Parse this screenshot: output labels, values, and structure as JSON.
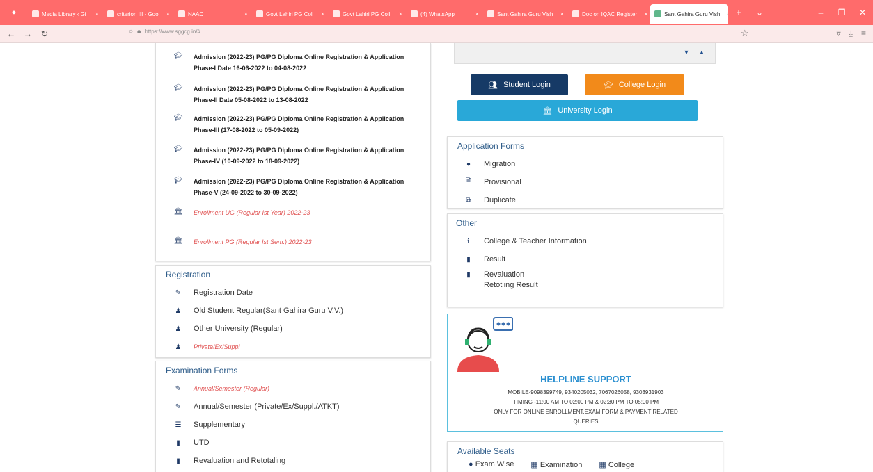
{
  "browser": {
    "tabs": [
      {
        "label": "Media Library ‹ Gi",
        "active": false
      },
      {
        "label": "criterion III - Goo",
        "active": false
      },
      {
        "label": "NAAC",
        "active": false
      },
      {
        "label": "Govt Lahiri PG Coll",
        "active": false
      },
      {
        "label": "Govt Lahiri PG Coll",
        "active": false
      },
      {
        "label": "(4) WhatsApp",
        "active": false
      },
      {
        "label": "Sant Gahira Guru Vish",
        "active": false
      },
      {
        "label": "Doc on IQAC Register",
        "active": false
      },
      {
        "label": "Sant Gahira Guru Vish",
        "active": true
      }
    ],
    "url": "https://www.sggcg.in/#"
  },
  "news": [
    {
      "text": "Admission (2022-23) PG/PG Diploma Online Registration & Application Phase-I Date 16-06-2022 to 04-08-2022",
      "style": "bold"
    },
    {
      "text": "Admission (2022-23) PG/PG Diploma Online Registration & Application Phase-II Date 05-08-2022 to 13-08-2022",
      "style": "bold"
    },
    {
      "text": "Admission (2022-23) PG/PG Diploma Online Registration & Application Phase-III (17-08-2022 to 05-09-2022)",
      "style": "bold"
    },
    {
      "text": "Admission (2022-23) PG/PG Diploma Online Registration & Application Phase-IV (10-09-2022 to 18-09-2022)",
      "style": "bold"
    },
    {
      "text": "Admission (2022-23) PG/PG Diploma Online Registration & Application Phase-V (24-09-2022 to 30-09-2022)",
      "style": "bold"
    },
    {
      "text": "Enrollment UG (Regular Ist Year) 2022-23",
      "style": "red"
    },
    {
      "text": "Enrollment PG (Regular Ist Sem.) 2022-23",
      "style": "red"
    }
  ],
  "registration": {
    "title": "Registration",
    "items": [
      {
        "label": "Registration Date",
        "icon": "edit-icon"
      },
      {
        "label": "Old Student Regular(Sant Gahira Guru V.V.)",
        "icon": "user-icon"
      },
      {
        "label": "Other University (Regular)",
        "icon": "user-icon"
      },
      {
        "label": "Private/Ex/Suppl",
        "icon": "user-icon"
      }
    ]
  },
  "exam_forms": {
    "title": "Examination Forms",
    "items": [
      {
        "label": "Annual/Semester (Regular)",
        "icon": "edit-icon"
      },
      {
        "label": "Annual/Semester (Private/Ex/Suppl./ATKT)",
        "icon": "edit-icon"
      },
      {
        "label": "Supplementary",
        "icon": "list-icon"
      },
      {
        "label": "UTD",
        "icon": "file-icon"
      },
      {
        "label": "Revaluation and Retotaling",
        "icon": "file-icon"
      }
    ]
  },
  "login": {
    "student": "Student Login",
    "college": "College Login",
    "university": "University Login",
    "colors": {
      "student": "#163a66",
      "college": "#f28a1a",
      "university": "#29a8d8"
    }
  },
  "application_forms": {
    "title": "Application Forms",
    "items": [
      {
        "label": "Migration",
        "icon": "bullet-icon"
      },
      {
        "label": "Provisional",
        "icon": "document-icon"
      },
      {
        "label": "Duplicate",
        "icon": "copy-icon"
      }
    ]
  },
  "other": {
    "title": "Other",
    "items": [
      {
        "label": "College & Teacher Information",
        "icon": "info-icon"
      },
      {
        "label": "Result",
        "icon": "bookmark-icon"
      },
      {
        "label": "Revaluation",
        "icon": "bookmark-icon"
      }
    ],
    "sub_label": "Retotling Result"
  },
  "helpline": {
    "title": "HELPLINE SUPPORT",
    "mobile": "MOBILE-9098399749, 9340205032, 7067026058, 9303931903",
    "timing": "TIMING -11:00 AM TO 02:00 PM & 02:30 PM TO 05:00 PM",
    "note1": "ONLY FOR ONLINE ENROLLMENT,EXAM FORM & PAYMENT RELATED",
    "note2": "QUERIES"
  },
  "seats": {
    "title": "Available Seats",
    "tabs": [
      "Exam Wise",
      "Examination",
      "College"
    ]
  }
}
